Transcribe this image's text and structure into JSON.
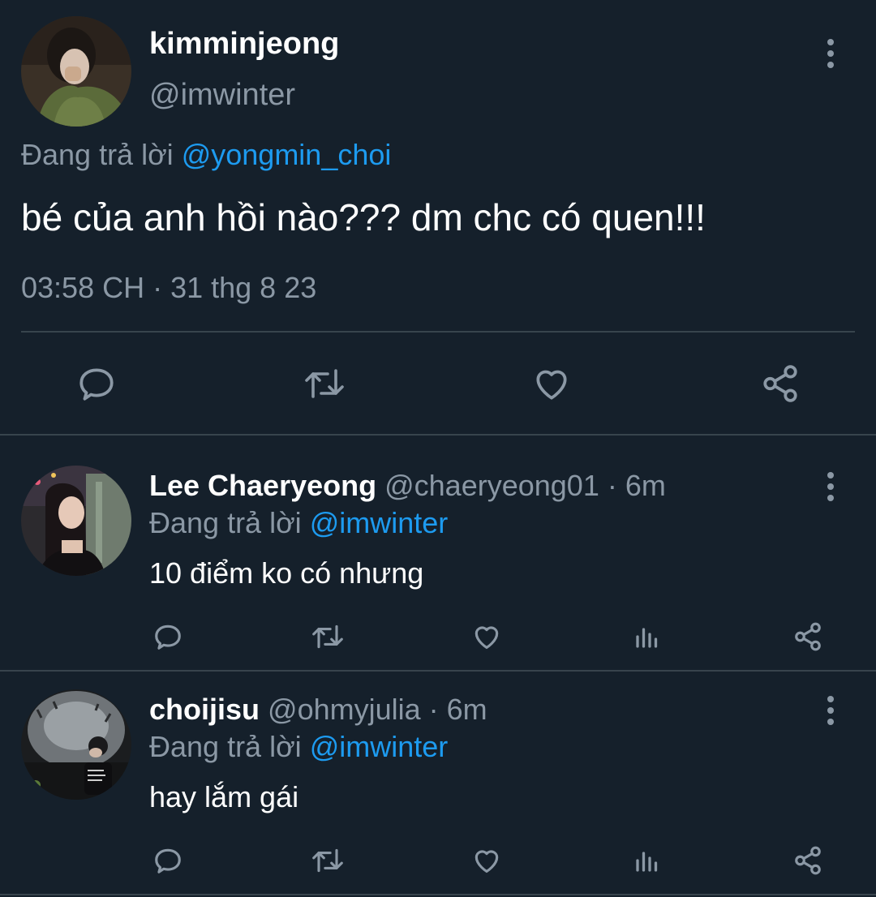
{
  "main_tweet": {
    "display_name": "kimminjeong",
    "handle": "@imwinter",
    "reply_prefix": "Đang trả lời",
    "reply_to": "@yongmin_choi",
    "text": "bé của anh hồi nào??? dm chc có quen!!!",
    "timestamp": "03:58 CH · 31 thg 8 23",
    "actions": [
      "reply-icon",
      "retweet-icon",
      "like-icon",
      "share-icon"
    ]
  },
  "replies": [
    {
      "display_name": "Lee Chaeryeong",
      "handle_time": "@chaeryeong01 · 6m",
      "reply_prefix": "Đang trả lời",
      "reply_to": "@imwinter",
      "text": "10 điểm ko có nhưng"
    },
    {
      "display_name": "choijisu",
      "handle_time": "@ohmyjulia · 6m",
      "reply_prefix": "Đang trả lời",
      "reply_to": "@imwinter",
      "text": "hay lắm gái"
    }
  ],
  "colors": {
    "background": "#15202b",
    "muted": "#8b98a5",
    "accent": "#1d9bf0",
    "divider": "#38444d"
  }
}
